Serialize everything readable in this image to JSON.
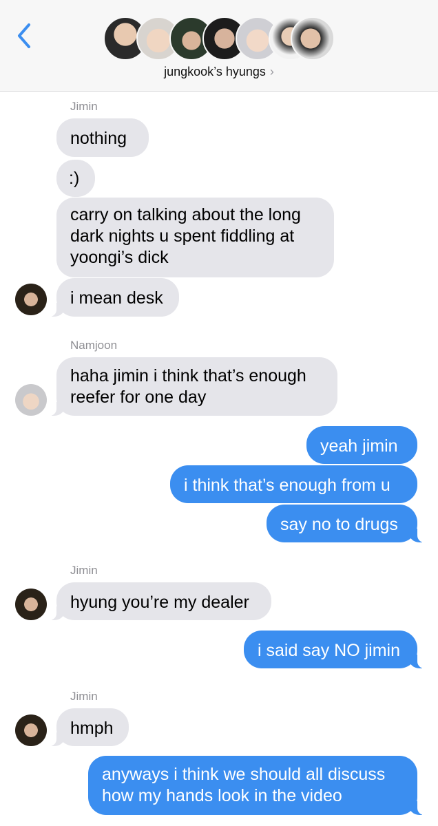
{
  "header": {
    "back_icon": "chevron-left-icon",
    "group_name": "jungkook’s hyungs",
    "chevron": "›",
    "accent_color": "#3b8ef0"
  },
  "messages": [
    {
      "type": "sender",
      "text": "Jimin"
    },
    {
      "type": "in",
      "text": "nothing"
    },
    {
      "type": "in",
      "text": ":)"
    },
    {
      "type": "in",
      "lines": [
        "carry on talking about the long",
        "dark nights u spent fiddling at",
        "yoongi’s dick"
      ]
    },
    {
      "type": "in",
      "text": "i mean desk",
      "avatar": "jimin-avatar"
    },
    {
      "type": "sender",
      "text": "Namjoon"
    },
    {
      "type": "in",
      "lines": [
        "haha jimin i think that’s enough",
        "reefer for one day"
      ],
      "avatar": "namjoon-avatar"
    },
    {
      "type": "out",
      "text": "yeah jimin"
    },
    {
      "type": "out",
      "text": "i think that’s enough from u"
    },
    {
      "type": "out",
      "text": "say no to drugs"
    },
    {
      "type": "sender",
      "text": "Jimin"
    },
    {
      "type": "in",
      "text": "hyung you’re my dealer",
      "avatar": "jimin-avatar"
    },
    {
      "type": "out",
      "text": "i said say NO jimin"
    },
    {
      "type": "sender",
      "text": "Jimin"
    },
    {
      "type": "in",
      "text": "hmph",
      "avatar": "jimin-avatar"
    },
    {
      "type": "out",
      "lines": [
        "anyways i think we should all discuss",
        "how my hands look in the video"
      ]
    }
  ],
  "colors": {
    "incoming_bubble": "#e5e5ea",
    "outgoing_bubble": "#3b8ef0",
    "sender_label": "#8e8e93"
  }
}
